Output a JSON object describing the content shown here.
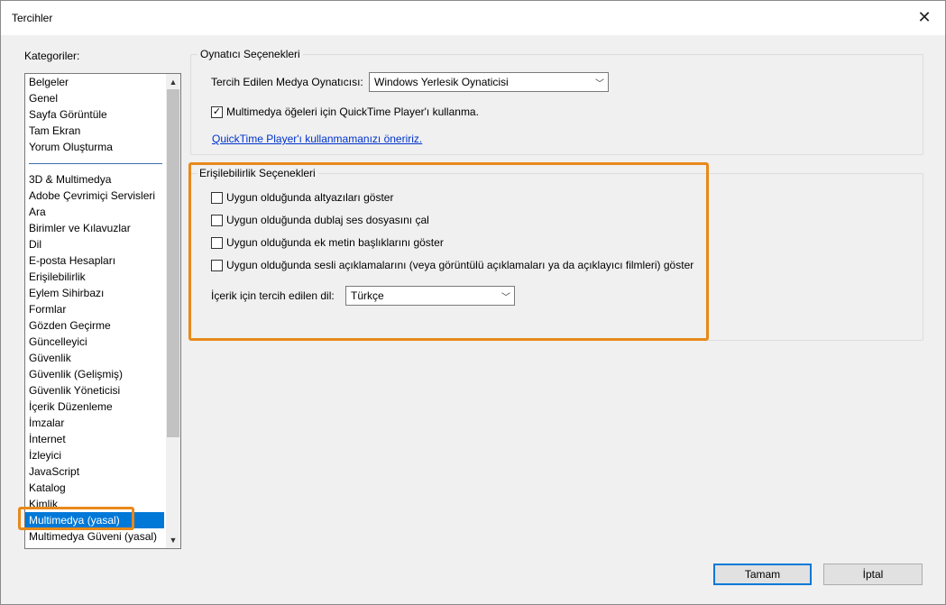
{
  "window": {
    "title": "Tercihler"
  },
  "categories": {
    "label": "Kategoriler:",
    "group1": [
      "Belgeler",
      "Genel",
      "Sayfa Görüntüle",
      "Tam Ekran",
      "Yorum Oluşturma"
    ],
    "group2": [
      "3D & Multimedya",
      "Adobe Çevrimiçi Servisleri",
      "Ara",
      "Birimler ve Kılavuzlar",
      "Dil",
      "E-posta Hesapları",
      "Erişilebilirlik",
      "Eylem Sihirbazı",
      "Formlar",
      "Gözden Geçirme",
      "Güncelleyici",
      "Güvenlik",
      "Güvenlik (Gelişmiş)",
      "Güvenlik Yöneticisi",
      "İçerik Düzenleme",
      "İmzalar",
      "İnternet",
      "İzleyici",
      "JavaScript",
      "Katalog",
      "Kimlik",
      "Multimedya (yasal)",
      "Multimedya Güveni (yasal)"
    ],
    "selected": "Multimedya (yasal)"
  },
  "player": {
    "group_title": "Oynatıcı Seçenekleri",
    "preferred_label": "Tercih Edilen Medya Oynatıcısı:",
    "preferred_value": "Windows Yerlesik Oynaticisi",
    "quicktime_label": "Multimedya öğeleri için QuickTime Player'ı kullanma.",
    "quicktime_checked": true,
    "link_text": "QuickTime Player'ı kullanmamanızı öneririz."
  },
  "accessibility": {
    "group_title": "Erişilebilirlik Seçenekleri",
    "options": [
      "Uygun olduğunda altyazıları göster",
      "Uygun olduğunda dublaj ses dosyasını çal",
      "Uygun olduğunda ek metin başlıklarını göster",
      "Uygun olduğunda sesli açıklamalarını (veya görüntülü açıklamaları ya da açıklayıcı filmleri) göster"
    ],
    "language_label": "İçerik için tercih edilen dil:",
    "language_value": "Türkçe"
  },
  "buttons": {
    "ok": "Tamam",
    "cancel": "İptal"
  },
  "colors": {
    "accent": "#0078d7",
    "highlight": "#e8891a",
    "link": "#0033cc"
  },
  "icons": {
    "close": "close-icon",
    "dropdown": "chevron-down-icon",
    "check": "check-icon"
  }
}
